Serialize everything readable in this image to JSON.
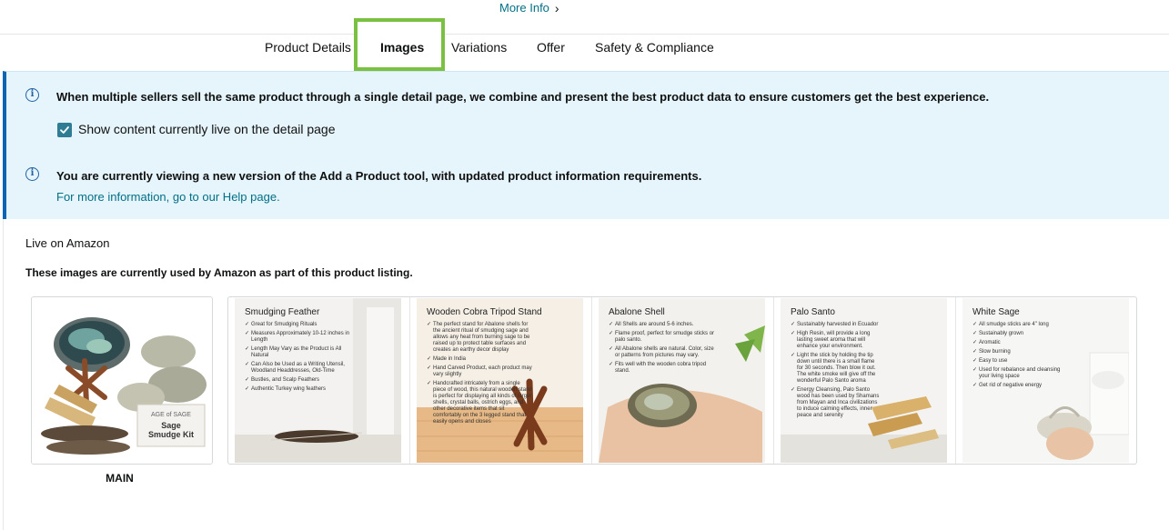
{
  "header": {
    "more_info_label": "More Info"
  },
  "tabs": [
    {
      "label": "Product Details",
      "active": false
    },
    {
      "label": "Images",
      "active": true
    },
    {
      "label": "Variations",
      "active": false
    },
    {
      "label": "Offer",
      "active": false
    },
    {
      "label": "Safety & Compliance",
      "active": false
    }
  ],
  "banner": {
    "message_1": "When multiple sellers sell the same product through a single detail page, we combine and present the best product data to ensure customers get the best experience.",
    "checkbox_label": "Show content currently live on the detail page",
    "checkbox_checked": true,
    "message_2": "You are currently viewing a new version of the Add a Product tool, with updated product information requirements.",
    "help_link": "For more information, go to our Help page."
  },
  "live": {
    "title": "Live on Amazon",
    "description": "These images are currently used by Amazon as part of this product listing.",
    "main_label": "MAIN",
    "main_kit_brand": "AGE of SAGE",
    "main_kit_name_1": "Sage",
    "main_kit_name_2": "Smudge Kit"
  },
  "images": [
    {
      "title": "Smudging Feather",
      "bullets": [
        "Great for Smudging Rituals",
        "Measures Approximately 10-12 inches in Length",
        "Length May Vary as the Product is All Natural",
        "Can Also be Used as a Writing Utensil, Woodland Headdresses, Old-Time",
        "Bustles, and Scalp Feathers",
        "Authentic Turkey wing feathers"
      ]
    },
    {
      "title": "Wooden Cobra Tripod Stand",
      "bullets": [
        "The perfect stand for Abalone shells for the ancient ritual of smudging sage and allows any heat from burning sage to be raised up to protect table surfaces and creates an earthy decor display",
        "Made in India",
        "Hand Carved Product, each product may vary slightly",
        "Handcrafted intricately from a single piece of wood, this natural wooden stand is perfect for displaying all kinds of larger shells, crystal balls, ostrich eggs, and other decorative items that sit comfortably on the 3 legged stand that easily opens and closes"
      ]
    },
    {
      "title": "Abalone Shell",
      "bullets": [
        "All Shells are around 5-6 inches.",
        "Flame proof, perfect for smudge sticks or palo santo.",
        "All Abalone shells are natural. Color, size or patterns from pictures may vary.",
        "Fits well with the wooden cobra tripod stand."
      ]
    },
    {
      "title": "Palo Santo",
      "bullets": [
        "Sustainably harvested in Ecuador",
        "High Resin, will provide a long lasting sweet aroma that will enhance your environment.",
        "Light the stick by holding the tip down until there is a small flame for 30 seconds. Then blow it out. The white smoke will give off the wonderful Palo Santo aroma",
        "Energy Cleansing, Palo Santo wood has been used by Shamans from Mayan and Inca civilizations to induce calming effects, inner peace and serenity"
      ]
    },
    {
      "title": "White Sage",
      "bullets": [
        "All smudge sticks are 4\" long",
        "Sustainably grown",
        "Aromatic",
        "Slow burning",
        "Easy to use",
        "Used for rebalance and cleansing your living space",
        "Get rid of negative energy"
      ]
    }
  ],
  "colors": {
    "link": "#007185",
    "banner_bg": "#e6f4fb",
    "banner_accent": "#0b64b4",
    "tab_highlight": "#7ac142",
    "checkbox": "#2e7d95"
  }
}
